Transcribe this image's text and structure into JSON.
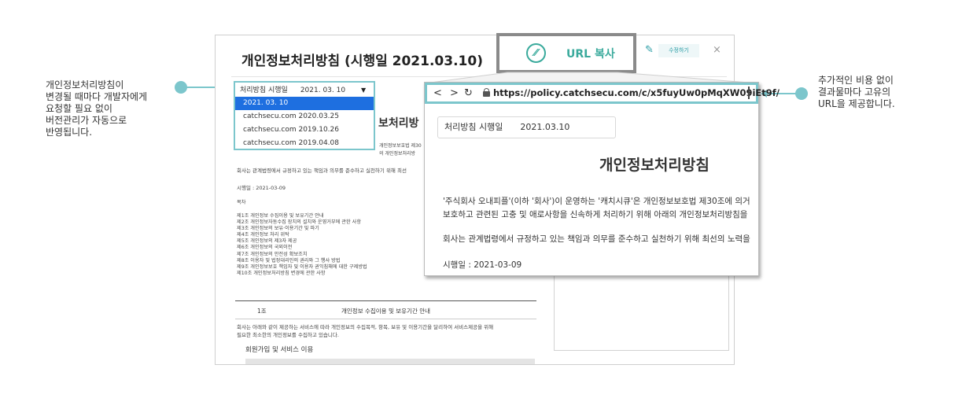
{
  "annotations": {
    "left": [
      "개인정보처리방침이",
      "변경될 때마다 개발자에게",
      "요청할 필요 없이",
      "버전관리가 자동으로",
      "반영됩니다."
    ],
    "right": [
      "추가적인 비용 없이",
      "결과물마다 고유의",
      "URL을 제공합니다."
    ]
  },
  "document": {
    "title": "개인정보처리방침 (시행일 2021.03.10)",
    "heading_partial": "보처리방",
    "partial_lines": [
      "개인정보보호법 제30",
      "의 개인정보처리방"
    ],
    "intro": "회사는 관계법령에서 규정하고 있는 책임과 의무를 준수하고 실천하기 위해 최선",
    "effective_date": "시행일 : 2021-03-09",
    "toc_title": "목차",
    "toc": [
      "제1조 개인정보 수집이용 및 보유기간 안내",
      "제2조 개인정보자동수집 장치의 설치와 운영거부에 관한 사항",
      "제3조 개인정보의 보유·이용기간 및 파기",
      "제4조 개인정보 처리 위탁",
      "제5조 개인정보의 제3자 제공",
      "제6조 개인정보의 국외이전",
      "제7조 개인정보의 안전성 확보조치",
      "제8조 이용자 및 법정대리인의 권리와 그 행사 방법",
      "제9조 개인정보보호 책임자 및 이용자 권익침해에 대한 구제방법",
      "제10조 개인정보처리방침 변경에 관한 사항"
    ],
    "section": {
      "number": "1조",
      "title": "개인정보 수집이용 및 보유기간 안내"
    },
    "section_body": [
      "회사는 아래와 같이 제공하는 서비스에 따라 개인정보의 수집목적, 항목, 보유 및 이용기간을 달리하여 서비스제공을 위해",
      "필요한 최소한의 개인정보를 수집하고 있습니다."
    ],
    "signup_title": "회원가입 및 서비스 이용"
  },
  "dropdown": {
    "label": "처리방침 시행일",
    "current": "2021. 03. 10",
    "caret": "▼",
    "options": [
      "2021. 03. 10",
      "catchsecu.com 2020.03.25",
      "catchsecu.com 2019.10.26",
      "catchsecu.com 2019.04.08"
    ],
    "selected_index": 0
  },
  "toolbar": {
    "url_copy_label": "URL 복사",
    "url_icon_name": "link-icon",
    "edit_label": "수정하기",
    "close": "×"
  },
  "browser": {
    "back": "<",
    "forward": ">",
    "reload": "↻",
    "url": "https://policy.catchsecu.com/c/x5fuyUw0pMqXW09iEt9f/",
    "date_label": "처리방침 시행일",
    "date_value": "2021.03.10",
    "title": "개인정보처리방침",
    "para1_line1": "'주식회사 오내피플'(이하 '회사')이 운영하는 '캐치시큐'은 개인정보보호법 제30조에 의거",
    "para1_line2": "보호하고 관련된 고충 및 애로사항을 신속하게 처리하기 위해 아래의 개인정보처리방침을",
    "para2": "회사는 관계법령에서 규정하고 있는 책임과 의무를 준수하고 실천하기 위해 최선의 노력을",
    "effective": "시행일 : 2021-03-09"
  },
  "colors": {
    "accent": "#7cc6cc",
    "brand_green": "#3aaa9c",
    "selected_blue": "#1e6fe0"
  }
}
